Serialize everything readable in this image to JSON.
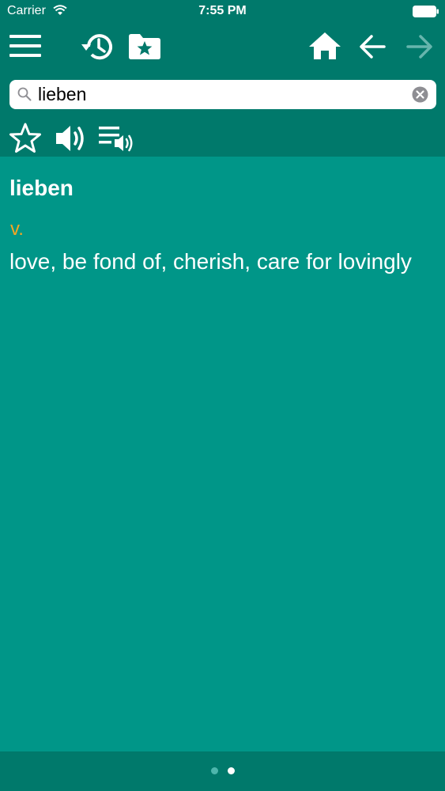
{
  "status_bar": {
    "carrier": "Carrier",
    "time": "7:55 PM"
  },
  "toolbar": {
    "icons": [
      "menu-icon",
      "history-icon",
      "favorites-folder-icon",
      "home-icon",
      "back-arrow-icon",
      "forward-arrow-icon"
    ]
  },
  "search": {
    "value": "lieben",
    "placeholder": ""
  },
  "actions": {
    "icons": [
      "star-icon",
      "speaker-icon",
      "playlist-audio-icon"
    ]
  },
  "entry": {
    "word": "lieben",
    "part_of_speech": "v.",
    "definition": "love, be fond of, cherish, care for lovingly"
  },
  "pagination": {
    "current_page": 2,
    "total_pages": 2
  },
  "colors": {
    "header": "#00796b",
    "content": "#009688",
    "accent_pos": "#f5a623",
    "disabled_forward": "#66b5ad"
  }
}
